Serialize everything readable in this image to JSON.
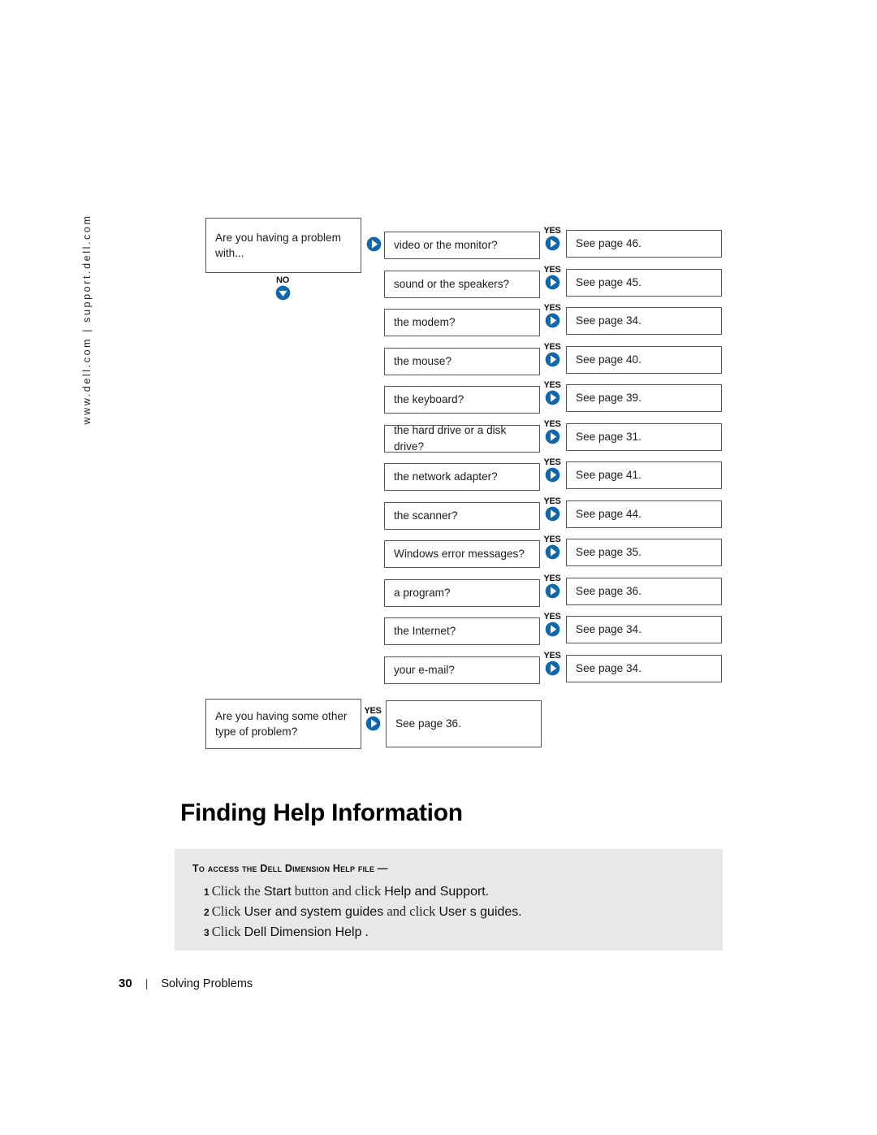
{
  "side_url": "www.dell.com | support.dell.com",
  "colors": {
    "arrow_blue": "#0F68AC",
    "box_border": "#575757",
    "panel_background": "#e8e8e8"
  },
  "flowchart": {
    "intro": {
      "line1": "Are you having a problem",
      "line2": "with..."
    },
    "no_marker": {
      "label": "NO",
      "icon": "circle-arrow-down-icon"
    },
    "entry_marker": {
      "label": "",
      "icon": "circle-arrow-right-icon"
    },
    "yes_label": "YES",
    "rows": [
      {
        "question": "video or the monitor?",
        "answer": "See page 46."
      },
      {
        "question": "sound or the speakers?",
        "answer": "See page 45."
      },
      {
        "question": "the modem?",
        "answer": "See page 34."
      },
      {
        "question": "the mouse?",
        "answer": "See page 40."
      },
      {
        "question": "the keyboard?",
        "answer": "See page 39."
      },
      {
        "question": "the hard drive or a disk drive?",
        "answer": "See page 31."
      },
      {
        "question": "the network adapter?",
        "answer": "See page 41."
      },
      {
        "question": "the scanner?",
        "answer": "See page 44."
      },
      {
        "question": "Windows error messages?",
        "answer": "See page 35."
      },
      {
        "question": "a program?",
        "answer": "See page 36."
      },
      {
        "question": "the Internet?",
        "answer": "See page 34."
      },
      {
        "question": "your e-mail?",
        "answer": "See page 34."
      }
    ],
    "other": {
      "line1": "Are you having some other",
      "line2": "type of problem?",
      "answer": "See page 36."
    }
  },
  "heading": "Finding Help Information",
  "panel": {
    "title": "To access the Dell Dimension Help file —",
    "steps": [
      {
        "num": "1",
        "parts": [
          {
            "text": "Click the ",
            "ui": false
          },
          {
            "text": "Start",
            "ui": true
          },
          {
            "text": " button and click ",
            "ui": false
          },
          {
            "text": "Help and Support",
            "ui": true
          },
          {
            "text": ".",
            "ui": false
          }
        ]
      },
      {
        "num": "2",
        "parts": [
          {
            "text": "Click ",
            "ui": false
          },
          {
            "text": "User and system guides",
            "ui": true
          },
          {
            "text": " and click ",
            "ui": false
          },
          {
            "text": "User s guides",
            "ui": true
          },
          {
            "text": ".",
            "ui": false
          }
        ]
      },
      {
        "num": "3",
        "parts": [
          {
            "text": "Click ",
            "ui": false
          },
          {
            "text": "Dell  Dimension  Help",
            "ui": true
          },
          {
            "text": "   .",
            "ui": false
          }
        ]
      }
    ]
  },
  "footer": {
    "page_number": "30",
    "separator": "|",
    "section": "Solving Problems"
  }
}
